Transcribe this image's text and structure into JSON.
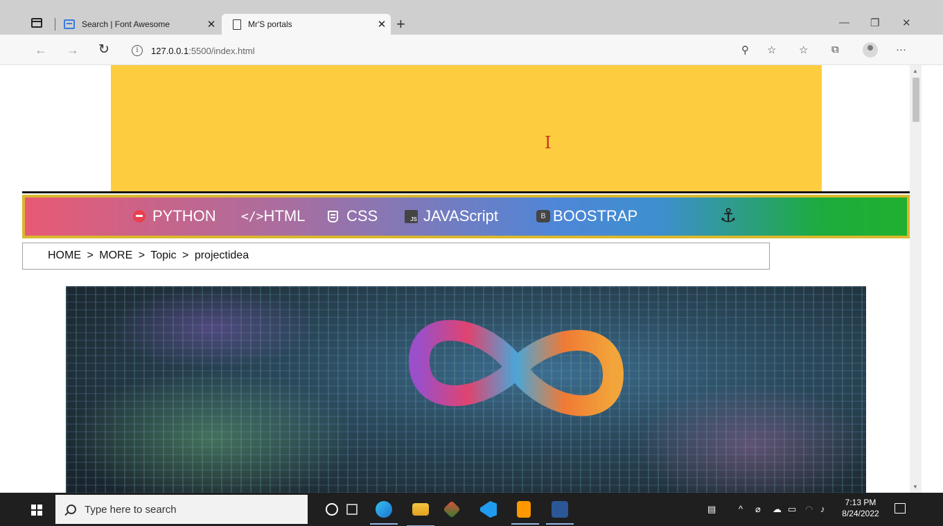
{
  "browser": {
    "tabs": [
      {
        "title": "Search | Font Awesome",
        "icon": "flag-icon",
        "active": false
      },
      {
        "title": "Mr'S portals",
        "icon": "page-icon",
        "active": true
      }
    ],
    "close_glyph": "✕",
    "new_tab_glyph": "+",
    "url_host": "127.0.0.1",
    "url_path": ":5500/index.html",
    "window_controls": {
      "minimize": "—",
      "restore": "❐",
      "close": "✕"
    }
  },
  "page": {
    "cursor_glyph": "I",
    "nav_items": [
      {
        "label": "PYTHON",
        "icon": "python-icon"
      },
      {
        "label": "HTML",
        "icon": "code-icon"
      },
      {
        "label": "CSS",
        "icon": "css3-icon"
      },
      {
        "label": "JAVAScript",
        "icon": "js-icon"
      },
      {
        "label": "BOOSTRAP",
        "icon": "bootstrap-icon"
      }
    ],
    "html_icon_text": "</>",
    "js_icon_text": "JS",
    "bs_icon_text": "B",
    "anchor_glyph": "⚓",
    "breadcrumb": [
      "HOME",
      "MORE",
      "Topic",
      "projectidea"
    ],
    "breadcrumb_sep": ">",
    "hero_image": "infinity-loop-circuit-board-image",
    "colors": {
      "banner": "#fecc3f",
      "nav_border": "#d9b82d",
      "gradient_start": "#e85a75",
      "gradient_mid": "#4f86d7",
      "gradient_end": "#20b02e"
    }
  },
  "taskbar": {
    "search_placeholder": "Type here to search",
    "time": "7:13 PM",
    "date": "8/24/2022"
  }
}
